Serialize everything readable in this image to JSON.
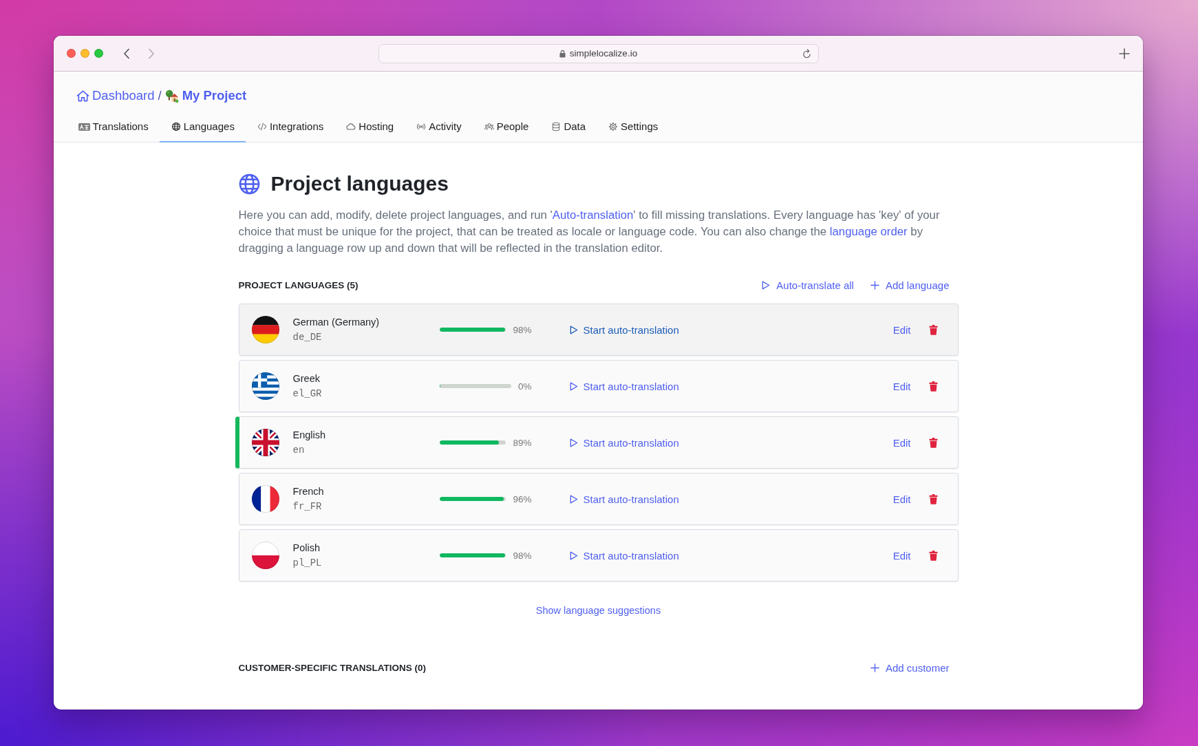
{
  "browser": {
    "url": "simplelocalize.io",
    "nav": [
      {
        "kind": "back",
        "disabled": false
      },
      {
        "kind": "forward",
        "disabled": true
      }
    ]
  },
  "breadcrumb": {
    "items": [
      {
        "kind": "home",
        "label": "Dashboard"
      },
      {
        "kind": "project",
        "label": "My Project"
      }
    ],
    "separator": "/"
  },
  "tabs": [
    {
      "kind": "translations",
      "label": "Translations",
      "selected": false
    },
    {
      "kind": "languages",
      "label": "Languages",
      "selected": true
    },
    {
      "kind": "integrations",
      "label": "Integrations",
      "selected": false
    },
    {
      "kind": "hosting",
      "label": "Hosting",
      "selected": false
    },
    {
      "kind": "activity",
      "label": "Activity",
      "selected": false
    },
    {
      "kind": "people",
      "label": "People",
      "selected": false
    },
    {
      "kind": "data",
      "label": "Data",
      "selected": false
    },
    {
      "kind": "settings",
      "label": "Settings",
      "selected": false
    }
  ],
  "page": {
    "title": "Project languages",
    "description": [
      {
        "kind": "text",
        "text": "Here you can add, modify, delete project languages, and run '"
      },
      {
        "kind": "link",
        "text": "Auto-translation"
      },
      {
        "kind": "text",
        "text": "' to fill missing translations. Every language has 'key' of your choice that must be unique for the project, that can be treated as locale or language code. You can also change the "
      },
      {
        "kind": "link",
        "text": "language order"
      },
      {
        "kind": "text",
        "text": " by dragging a language row up and down that will be reflected in the translation editor."
      }
    ]
  },
  "languages": {
    "heading": "PROJECT LANGUAGES (5)",
    "actions": [
      {
        "kind": "play",
        "label": "Auto-translate all"
      },
      {
        "kind": "add",
        "label": "Add language"
      }
    ],
    "rows": [
      {
        "kind": "germany",
        "name": "German (Germany)",
        "code": "de_DE",
        "level": 0.98,
        "percent": "98%",
        "action": "Start auto-translation",
        "edit": "Edit",
        "hovered": true,
        "marked": false
      },
      {
        "kind": "greece",
        "name": "Greek",
        "code": "el_GR",
        "level": 0,
        "percent": "0%",
        "action": "Start auto-translation",
        "edit": "Edit",
        "hovered": false,
        "marked": false
      },
      {
        "kind": "uk",
        "name": "English",
        "code": "en",
        "level": 0.89,
        "percent": "89%",
        "action": "Start auto-translation",
        "edit": "Edit",
        "hovered": false,
        "marked": true
      },
      {
        "kind": "france",
        "name": "French",
        "code": "fr_FR",
        "level": 0.96,
        "percent": "96%",
        "action": "Start auto-translation",
        "edit": "Edit",
        "hovered": false,
        "marked": false
      },
      {
        "kind": "poland",
        "name": "Polish",
        "code": "pl_PL",
        "level": 0.98,
        "percent": "98%",
        "action": "Start auto-translation",
        "edit": "Edit",
        "hovered": false,
        "marked": false
      }
    ],
    "suggestions_link": "Show language suggestions"
  },
  "customers": {
    "heading": "CUSTOMER-SPECIFIC TRANSLATIONS (0)",
    "actions": [
      {
        "kind": "add",
        "label": "Add customer"
      }
    ]
  }
}
